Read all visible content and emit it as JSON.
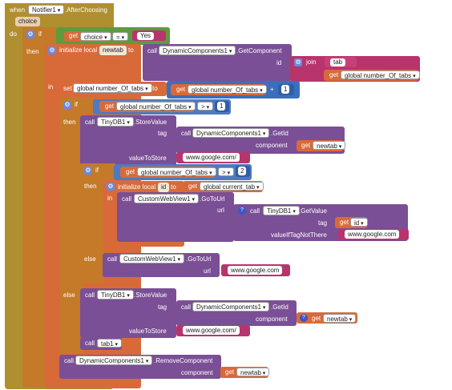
{
  "event": {
    "when": "when",
    "component": "Notifier1",
    "event": ".AfterChoosing",
    "param": "choice",
    "do": "do"
  },
  "if1": {
    "if": "if",
    "then": "then",
    "else": "else"
  },
  "cond1": {
    "get": "get",
    "var": "choice",
    "op": "=",
    "val": "Yes"
  },
  "init_newtab": {
    "label": "initialize local",
    "name": "newtab",
    "to": "to",
    "in": "in"
  },
  "getcomp": {
    "call": "call",
    "component": "DynamicComponents1",
    "method": ".GetComponent",
    "id_label": "id"
  },
  "join": {
    "label": "join",
    "s1": "tab",
    "get": "get",
    "var": "global number_Of_tabs"
  },
  "set_tabs": {
    "set": "set",
    "var": "global number_Of_tabs",
    "to": "to",
    "get": "get",
    "var2": "global number_Of_tabs",
    "op": "+",
    "num": "1"
  },
  "if2": {
    "if": "if",
    "get": "get",
    "var": "global number_Of_tabs",
    "op": ">",
    "num": "1",
    "then": "then",
    "else": "else"
  },
  "store1": {
    "call": "call",
    "component": "TinyDB1",
    "method": ".StoreValue",
    "tag_label": "tag",
    "getid_call": "call",
    "getid_comp": "DynamicComponents1",
    "getid_method": ".GetId",
    "component_label": "component",
    "get": "get",
    "var": "newtab",
    "value_label": "valueToStore",
    "value": "www.google.com/"
  },
  "if3": {
    "if": "if",
    "get": "get",
    "var": "global number_Of_tabs",
    "op": ">",
    "num": "2",
    "then": "then",
    "else": "else"
  },
  "init_id": {
    "label": "initialize local",
    "name": "id",
    "to": "to",
    "get": "get",
    "var": "global current_tab",
    "in": "in"
  },
  "gotourl1": {
    "call": "call",
    "component": "CustomWebView1",
    "method": ".GoToUrl",
    "url_label": "url"
  },
  "getvalue": {
    "call": "call",
    "component": "TinyDB1",
    "method": ".GetValue",
    "tag_label": "tag",
    "get": "get",
    "var": "id",
    "default_label": "valueIfTagNotThere",
    "default": "www.google.com"
  },
  "gotourl2": {
    "call": "call",
    "component": "CustomWebView1",
    "method": ".GoToUrl",
    "url_label": "url",
    "value": "www.google.com"
  },
  "store2": {
    "call": "call",
    "component": "TinyDB1",
    "method": ".StoreValue",
    "tag_label": "tag",
    "getid_call": "call",
    "getid_comp": "DynamicComponents1",
    "getid_method": ".GetId",
    "component_label": "component",
    "get": "get",
    "var": "newtab",
    "value_label": "valueToStore",
    "value": "www.google.com/"
  },
  "tab1": {
    "call": "call",
    "component": "tab1"
  },
  "remove": {
    "call": "call",
    "component": "DynamicComponents1",
    "method": ".RemoveComponent",
    "component_label": "component",
    "get": "get",
    "var": "newtab"
  }
}
